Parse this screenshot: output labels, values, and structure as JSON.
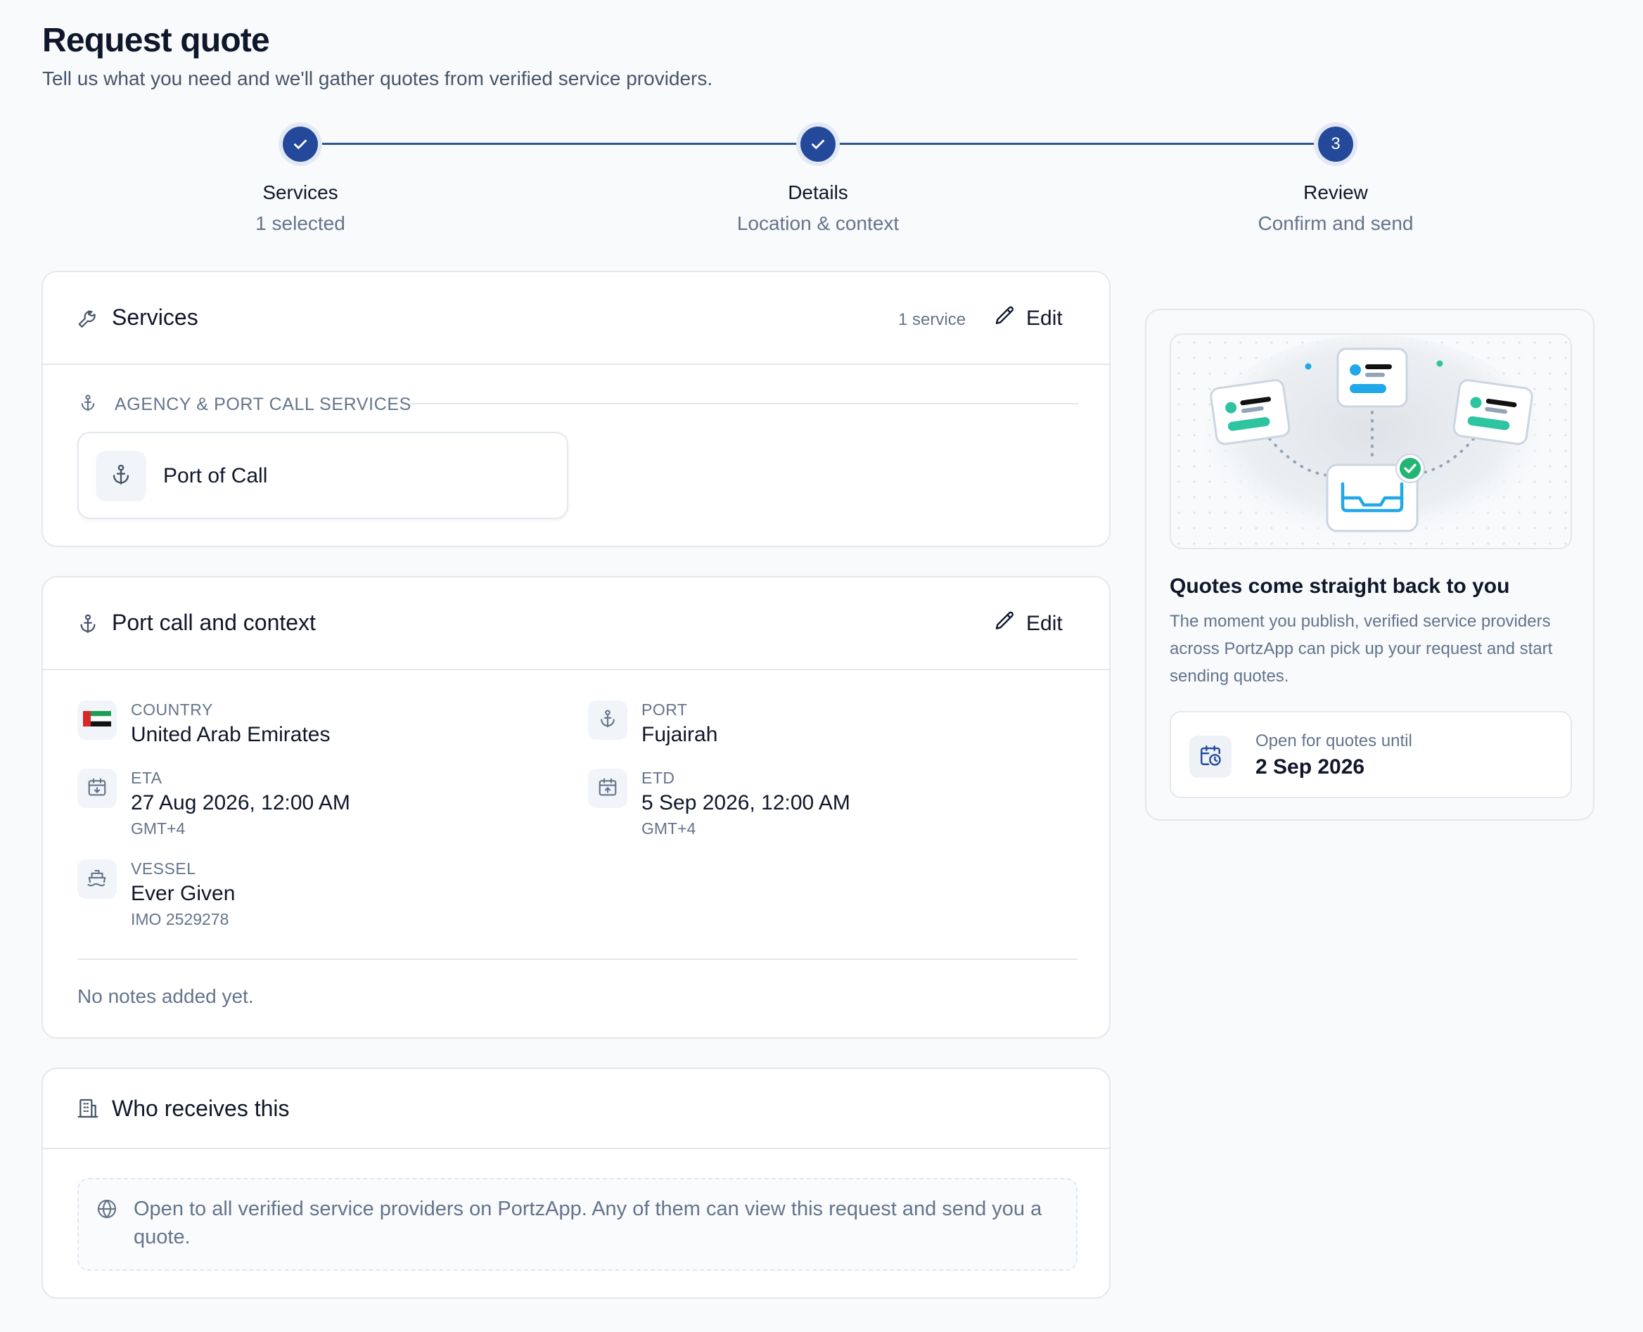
{
  "page": {
    "title": "Request quote",
    "subtitle": "Tell us what you need and we'll gather quotes from verified service providers."
  },
  "stepper": {
    "steps": [
      {
        "label": "Services",
        "sub": "1 selected",
        "state": "complete"
      },
      {
        "label": "Details",
        "sub": "Location & context",
        "state": "complete"
      },
      {
        "label": "Review",
        "sub": "Confirm and send",
        "state": "current",
        "number": "3"
      }
    ]
  },
  "services_card": {
    "title": "Services",
    "count": "1 service",
    "edit_label": "Edit",
    "category_label": "AGENCY & PORT CALL SERVICES",
    "items": [
      {
        "label": "Port of Call",
        "icon": "anchor-icon"
      }
    ]
  },
  "port_call_card": {
    "title": "Port call and context",
    "edit_label": "Edit",
    "country": {
      "label": "COUNTRY",
      "value": "United Arab Emirates"
    },
    "port": {
      "label": "PORT",
      "value": "Fujairah"
    },
    "eta": {
      "label": "ETA",
      "value": "27 Aug 2026, 12:00 AM",
      "tz": "GMT+4"
    },
    "etd": {
      "label": "ETD",
      "value": "5 Sep 2026, 12:00 AM",
      "tz": "GMT+4"
    },
    "vessel": {
      "label": "VESSEL",
      "value": "Ever Given",
      "imo": "IMO 2529278"
    },
    "notes": "No notes added yet."
  },
  "recipients_card": {
    "title": "Who receives this",
    "line1": "Open to all verified service providers on PortzApp. Any of them can view this request and send you a",
    "line2": "quote."
  },
  "side_panel": {
    "title": "Quotes come straight back to you",
    "body_lines": [
      "The moment you publish, verified service providers",
      "across PortzApp can pick up your request and start",
      "sending quotes."
    ],
    "deadline_label": "Open for quotes until",
    "deadline_value": "2 Sep 2026"
  },
  "colors": {
    "accent": "#24499a",
    "teal": "#2ec4a0",
    "sky": "#22a7e8",
    "border": "#e5e7eb",
    "muted": "#64748b"
  }
}
